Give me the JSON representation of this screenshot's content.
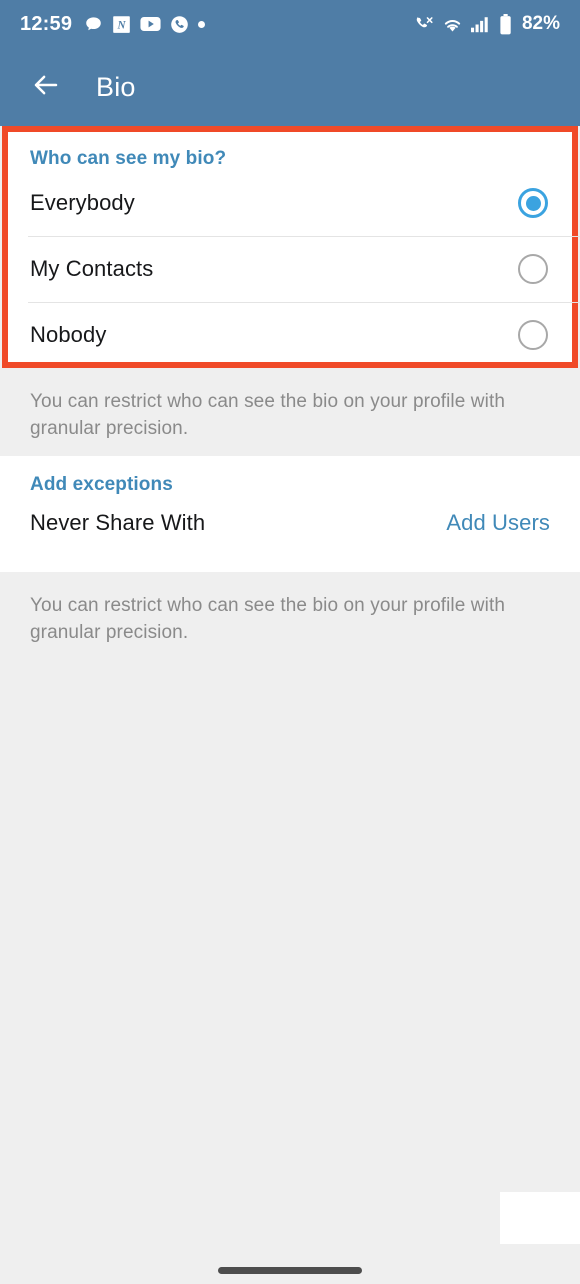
{
  "status_bar": {
    "time": "12:59",
    "battery_percent": "82%",
    "left_icons": [
      "chat-bubble-icon",
      "note-app-icon",
      "youtube-icon",
      "phone-circle-icon",
      "more-dot-icon"
    ],
    "right_icons": [
      "phone-signal-icon",
      "wifi-icon",
      "cellular-signal-icon",
      "battery-icon"
    ]
  },
  "app_bar": {
    "back_icon": "arrow-left-icon",
    "title": "Bio"
  },
  "privacy_section": {
    "title": "Who can see my bio?",
    "options": [
      {
        "label": "Everybody",
        "selected": true
      },
      {
        "label": "My Contacts",
        "selected": false
      },
      {
        "label": "Nobody",
        "selected": false
      }
    ],
    "footer": "You can restrict who can see the bio on your profile with granular precision."
  },
  "exceptions_section": {
    "title": "Add exceptions",
    "row_label": "Never Share With",
    "action_label": "Add Users",
    "footer": "You can restrict who can see the bio on your profile with granular precision."
  },
  "colors": {
    "header_blue": "#4f7da6",
    "accent_blue": "#4089b8",
    "radio_selected": "#3ba3e0",
    "highlight_red": "#f04a28",
    "page_background": "#efefef",
    "card_background": "#ffffff",
    "primary_text": "#17181a",
    "secondary_text": "#8a8a8a"
  },
  "nav_bar": {
    "home_indicator": "home-indicator-pill"
  }
}
